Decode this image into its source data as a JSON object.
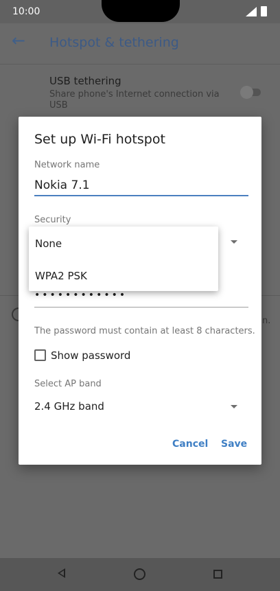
{
  "status_bar": {
    "time": "10:00"
  },
  "app_bar": {
    "title": "Hotspot & tethering",
    "back_icon": "arrow-back-icon"
  },
  "background_setting": {
    "title": "USB tethering",
    "subtitle": "Share phone's Internet connection via USB",
    "edge_text": "n."
  },
  "dialog": {
    "title": "Set up Wi-Fi hotspot",
    "network_name_label": "Network name",
    "network_name_value": "Nokia 7.1",
    "security_label": "Security",
    "password_mask": "••••••••••••",
    "password_hint": "The password must contain at least 8 characters.",
    "show_password_label": "Show password",
    "show_password_checked": false,
    "ap_band_label": "Select AP band",
    "ap_band_value": "2.4 GHz band",
    "cancel_label": "Cancel",
    "save_label": "Save"
  },
  "security_menu": {
    "options": [
      "None",
      "WPA2 PSK"
    ]
  },
  "colors": {
    "accent": "#3f7fc4",
    "app_title": "#3c5a86",
    "scrim": "#6a6a6a"
  }
}
